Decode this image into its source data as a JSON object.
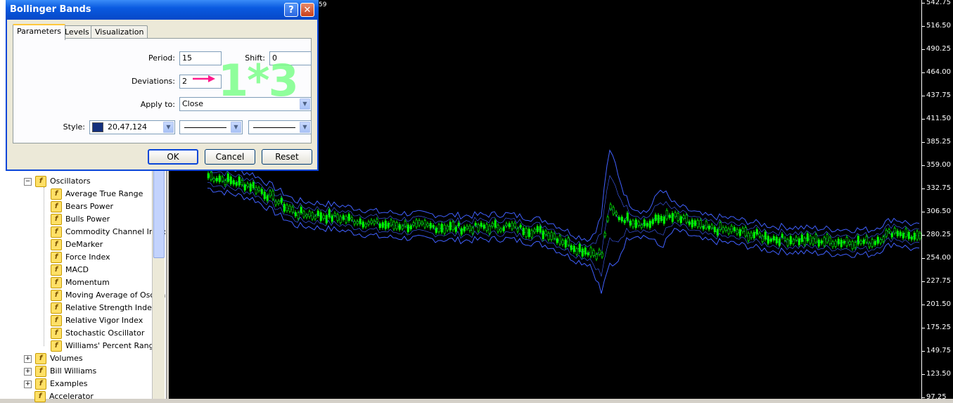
{
  "dialog": {
    "title": "Bollinger Bands",
    "help_glyph": "?",
    "close_glyph": "✕",
    "tabs": [
      {
        "label": "Parameters",
        "active": true
      },
      {
        "label": "Levels",
        "active": false
      },
      {
        "label": "Visualization",
        "active": false
      }
    ],
    "params": {
      "period_label": "Period:",
      "period_value": "15",
      "shift_label": "Shift:",
      "shift_value": "0",
      "deviations_label": "Deviations:",
      "deviations_value": "2",
      "apply_label": "Apply to:",
      "apply_value": "Close",
      "style_label": "Style:",
      "style_color": "20,47,124",
      "style_color_hex": "#142f7c"
    },
    "buttons": {
      "ok": "OK",
      "cancel": "Cancel",
      "reset": "Reset"
    },
    "annotation_text": "1*3",
    "annotation_color": "#7dff8a",
    "arrow_color": "#ff1a8c"
  },
  "navigator": {
    "items": [
      {
        "label": "Oscillators",
        "kind": "folder",
        "level": 1
      },
      {
        "label": "Average True Range",
        "kind": "indicator",
        "level": 2
      },
      {
        "label": "Bears Power",
        "kind": "indicator",
        "level": 2
      },
      {
        "label": "Bulls Power",
        "kind": "indicator",
        "level": 2
      },
      {
        "label": "Commodity Channel Inde:",
        "kind": "indicator",
        "level": 2
      },
      {
        "label": "DeMarker",
        "kind": "indicator",
        "level": 2
      },
      {
        "label": "Force Index",
        "kind": "indicator",
        "level": 2
      },
      {
        "label": "MACD",
        "kind": "indicator",
        "level": 2
      },
      {
        "label": "Momentum",
        "kind": "indicator",
        "level": 2
      },
      {
        "label": "Moving Average of Oscilla",
        "kind": "indicator",
        "level": 2
      },
      {
        "label": "Relative Strength Index",
        "kind": "indicator",
        "level": 2
      },
      {
        "label": "Relative Vigor Index",
        "kind": "indicator",
        "level": 2
      },
      {
        "label": "Stochastic Oscillator",
        "kind": "indicator",
        "level": 2
      },
      {
        "label": "Williams' Percent Range",
        "kind": "indicator",
        "level": 2
      },
      {
        "label": "Volumes",
        "kind": "folder",
        "level": 1
      },
      {
        "label": "Bill Williams",
        "kind": "folder",
        "level": 1
      },
      {
        "label": "Examples",
        "kind": "folder",
        "level": 1
      },
      {
        "label": "Accelerator",
        "kind": "indicator",
        "level": 1
      }
    ]
  },
  "chart": {
    "header_fragment": "59",
    "price_labels": [
      "542.75",
      "516.50",
      "490.25",
      "464.00",
      "437.75",
      "411.50",
      "385.25",
      "359.00",
      "332.75",
      "306.50",
      "280.25",
      "254.00",
      "227.75",
      "201.50",
      "175.25",
      "149.75",
      "123.50",
      "97.25"
    ],
    "candle_color": "#00ff00",
    "band_color": "#4060ff"
  }
}
